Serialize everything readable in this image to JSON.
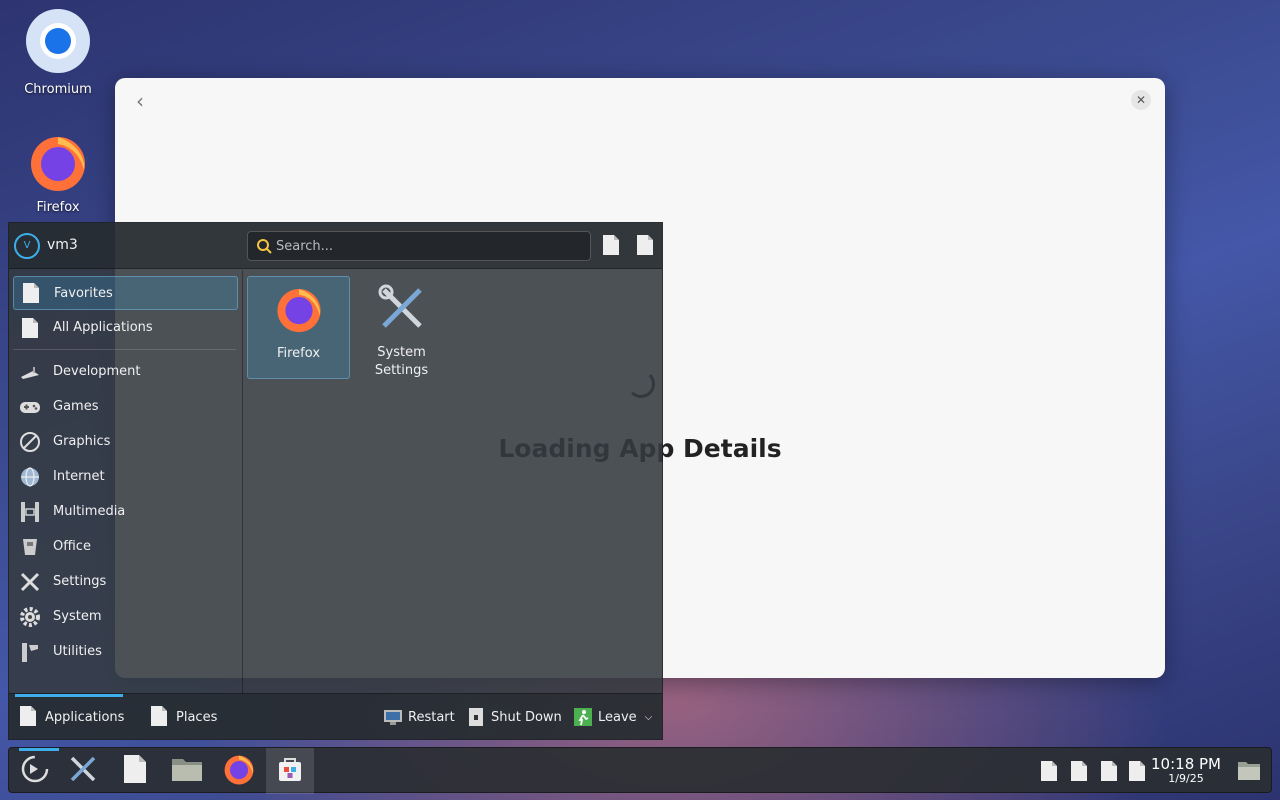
{
  "desktop": {
    "icons": [
      {
        "label": "Chromium",
        "icon": "chromium-icon"
      },
      {
        "label": "Firefox",
        "icon": "firefox-icon"
      }
    ]
  },
  "app_window": {
    "loading_text": "Loading App Details",
    "back_icon": "chevron-left-icon",
    "close_icon": "close-icon"
  },
  "launcher": {
    "user": {
      "name": "vm3",
      "avatar_initial": "V"
    },
    "search": {
      "placeholder": "Search..."
    },
    "sidebar": {
      "top": [
        {
          "label": "Favorites",
          "icon": "document-icon"
        },
        {
          "label": "All Applications",
          "icon": "document-icon"
        }
      ],
      "categories": [
        {
          "label": "Development",
          "icon": "trowel-icon"
        },
        {
          "label": "Games",
          "icon": "gamepad-icon"
        },
        {
          "label": "Graphics",
          "icon": "graphics-icon"
        },
        {
          "label": "Internet",
          "icon": "globe-icon"
        },
        {
          "label": "Multimedia",
          "icon": "film-icon"
        },
        {
          "label": "Office",
          "icon": "office-icon"
        },
        {
          "label": "Settings",
          "icon": "tools-icon"
        },
        {
          "label": "System",
          "icon": "gear-icon"
        },
        {
          "label": "Utilities",
          "icon": "utilities-icon"
        }
      ]
    },
    "favorites": [
      {
        "label": "Firefox",
        "icon": "firefox-icon"
      },
      {
        "label": "System Settings",
        "icon": "tools-icon"
      }
    ],
    "footer": {
      "tabs": [
        {
          "label": "Applications"
        },
        {
          "label": "Places"
        }
      ],
      "actions": [
        {
          "label": "Restart",
          "icon": "restart-icon"
        },
        {
          "label": "Shut Down",
          "icon": "shutdown-icon"
        },
        {
          "label": "Leave",
          "icon": "leave-icon"
        }
      ]
    }
  },
  "taskbar": {
    "items": [
      {
        "name": "launcher",
        "icon": "launcher-icon"
      },
      {
        "name": "system-settings",
        "icon": "tools-icon"
      },
      {
        "name": "document",
        "icon": "document-icon"
      },
      {
        "name": "file-manager",
        "icon": "folder-icon"
      },
      {
        "name": "firefox",
        "icon": "firefox-icon"
      },
      {
        "name": "discover",
        "icon": "store-icon"
      }
    ],
    "clock": {
      "time": "10:18 PM",
      "date": "1/9/25"
    }
  },
  "colors": {
    "accent": "#3daee9",
    "window_bg": "#f7f7f7",
    "panel_bg": "#343a40"
  }
}
